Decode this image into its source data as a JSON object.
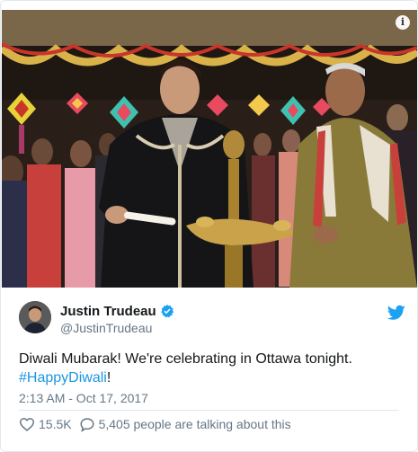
{
  "tweet": {
    "author_name": "Justin Trudeau",
    "author_handle": "@JustinTrudeau",
    "text_before": "Diwali Mubarak! We're celebrating in Ottawa tonight.",
    "hashtag": "#HappyDiwali",
    "text_after": "!",
    "timestamp": "2:13 AM - Oct 17, 2017",
    "likes": "15.5K",
    "comments_text": "5,405 people are talking about this"
  },
  "icons": {
    "info": "info-icon",
    "verified": "verified-badge-icon",
    "brand": "twitter-bird-icon",
    "like": "heart-icon",
    "comment": "speech-bubble-icon"
  },
  "colors": {
    "link": "#1b95e0",
    "verified": "#1da1f2",
    "muted": "#657786",
    "text": "#14171a"
  }
}
